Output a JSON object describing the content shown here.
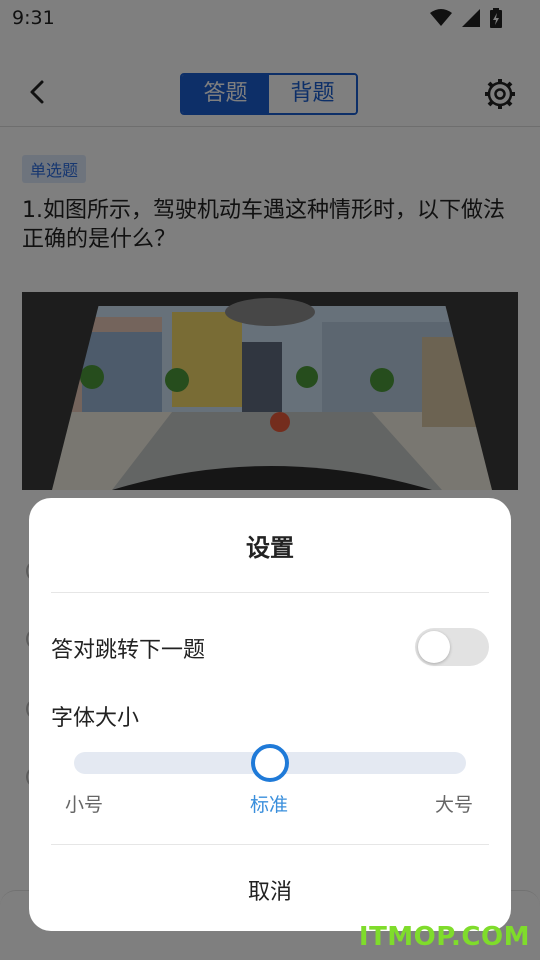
{
  "status_bar": {
    "time": "9:31"
  },
  "header": {
    "tabs": [
      {
        "label": "答题",
        "active": true
      },
      {
        "label": "背题",
        "active": false
      }
    ]
  },
  "question": {
    "type_badge": "单选题",
    "text": "1.如图所示，驾驶机动车遇这种情形时，以下做法正确的是什么？"
  },
  "settings_dialog": {
    "title": "设置",
    "auto_next_label": "答对跳转下一题",
    "auto_next_enabled": false,
    "font_size_label": "字体大小",
    "font_size_options": [
      "小号",
      "标准",
      "大号"
    ],
    "font_size_selected": "标准",
    "cancel_label": "取消"
  },
  "watermark": "ITMOP.COM",
  "colors": {
    "primary": "#1a5fd1",
    "slider_accent": "#1f7ad8",
    "watermark": "#7fdc2b"
  }
}
